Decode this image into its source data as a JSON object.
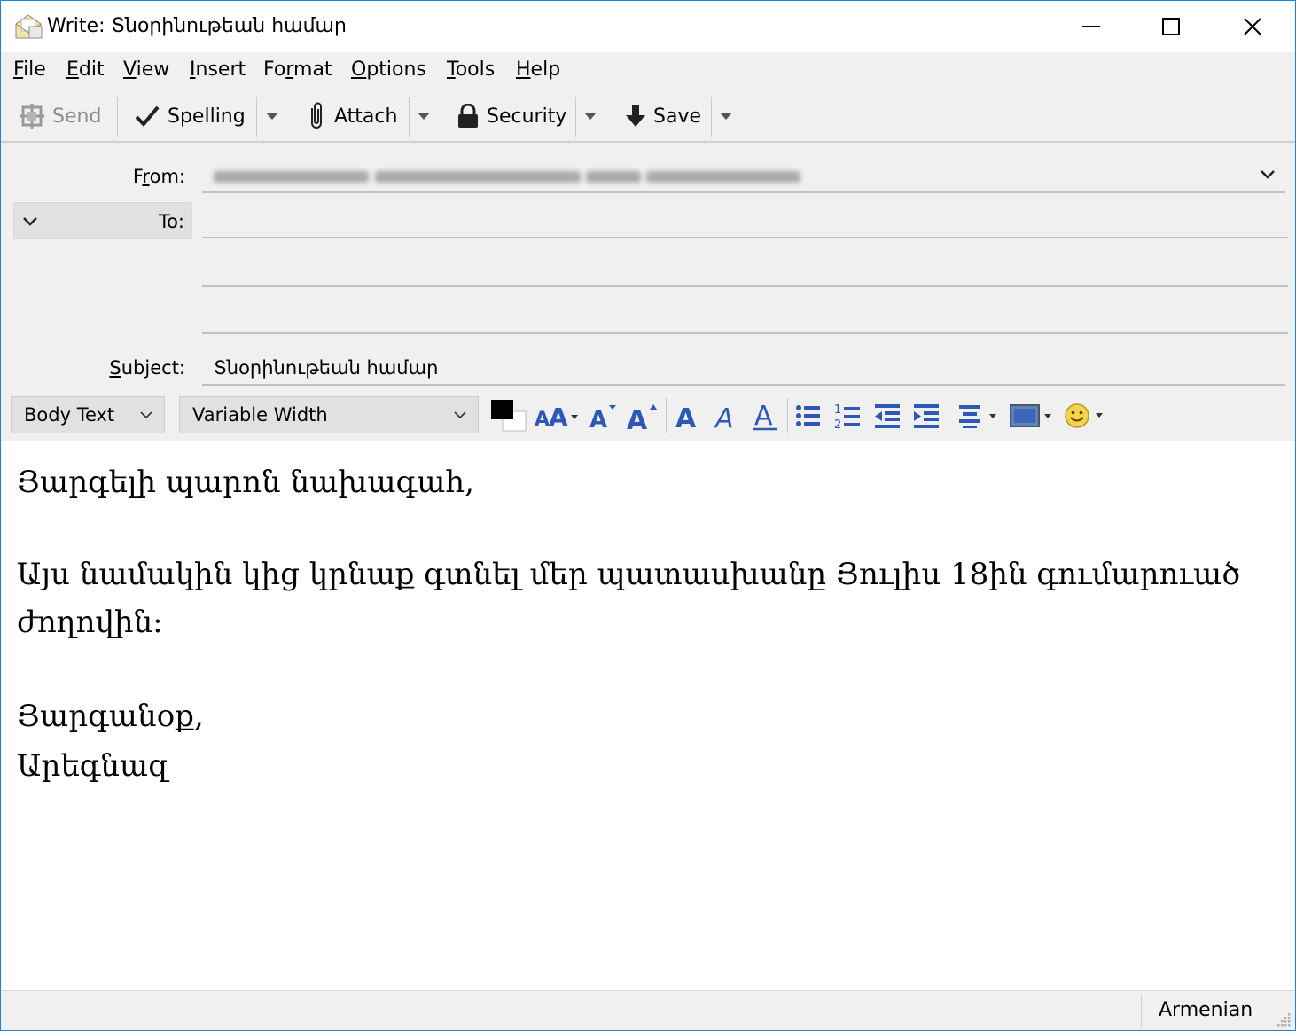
{
  "window": {
    "title": "Write: Տնօրինութեան համար",
    "minimize_icon": "minimize-icon",
    "maximize_icon": "maximize-icon",
    "close_icon": "close-icon"
  },
  "menu": {
    "items": [
      {
        "key": "F",
        "rest": "ile"
      },
      {
        "key": "E",
        "rest": "dit"
      },
      {
        "key": "V",
        "rest": "iew"
      },
      {
        "key": "I",
        "rest": "nsert"
      },
      {
        "pre": "Fo",
        "key": "r",
        "rest": "mat"
      },
      {
        "key": "O",
        "rest": "ptions"
      },
      {
        "key": "T",
        "rest": "ools"
      },
      {
        "key": "H",
        "rest": "elp"
      }
    ]
  },
  "toolbar": {
    "send_label": "Send",
    "spelling_label": "Spelling",
    "attach_label": "Attach",
    "security_label": "Security",
    "save_label": "Save"
  },
  "headers": {
    "from_label_pre": "F",
    "from_label_key": "r",
    "from_label_post": "om:",
    "to_label": "To:",
    "subject_label_key": "S",
    "subject_label_post": "ubject:",
    "subject_value": "Տնօրինութեան համար"
  },
  "format_bar": {
    "paragraph_style": "Body Text",
    "font": "Variable Width",
    "text_color": "#000000",
    "background_color": "#ffffff",
    "accent_color": "#2c59b5"
  },
  "message": {
    "lines": [
      "Յարգելի պարոն նախագահ,",
      "",
      "Այս նամակին կից կրնաք գտնել մեր պատասխանը Յուլիս 18ին գումարուած",
      "ժողովին:",
      "",
      "Յարգանօք,",
      "Արեգնազ"
    ]
  },
  "status": {
    "language": "Armenian"
  }
}
